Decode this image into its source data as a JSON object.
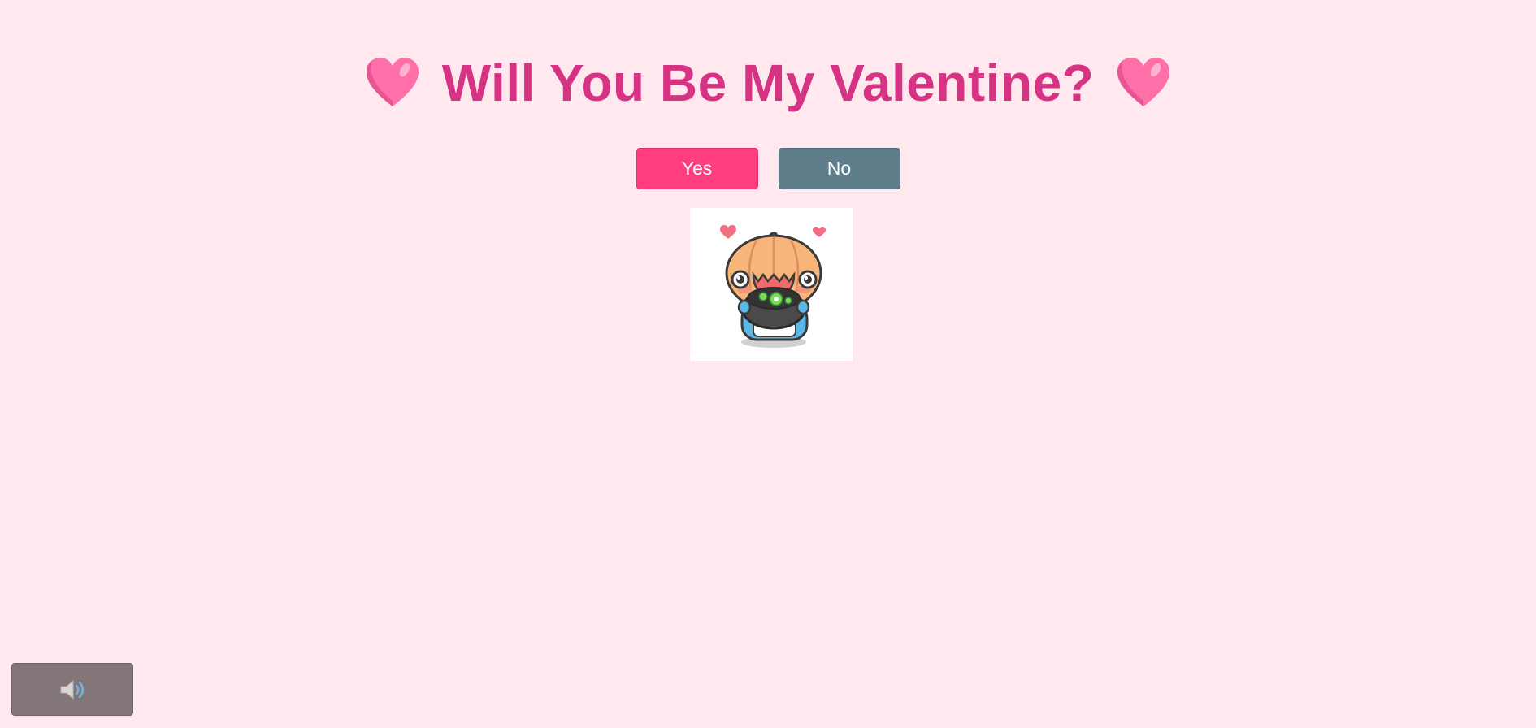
{
  "header": {
    "title": "Will You Be My Valentine?",
    "left_icon": "pink-heart-icon",
    "right_icon": "pink-heart-icon"
  },
  "buttons": {
    "yes_label": "Yes",
    "no_label": "No"
  },
  "sticker": {
    "description_icon": "pumpkin-cauldron-sticker"
  },
  "audio": {
    "icon": "speaker-icon"
  },
  "colors": {
    "background": "#ffe9ee",
    "title": "#d63384",
    "yes_button": "#ff3d7f",
    "no_button": "#607d8b",
    "sound_button": "#827679"
  }
}
